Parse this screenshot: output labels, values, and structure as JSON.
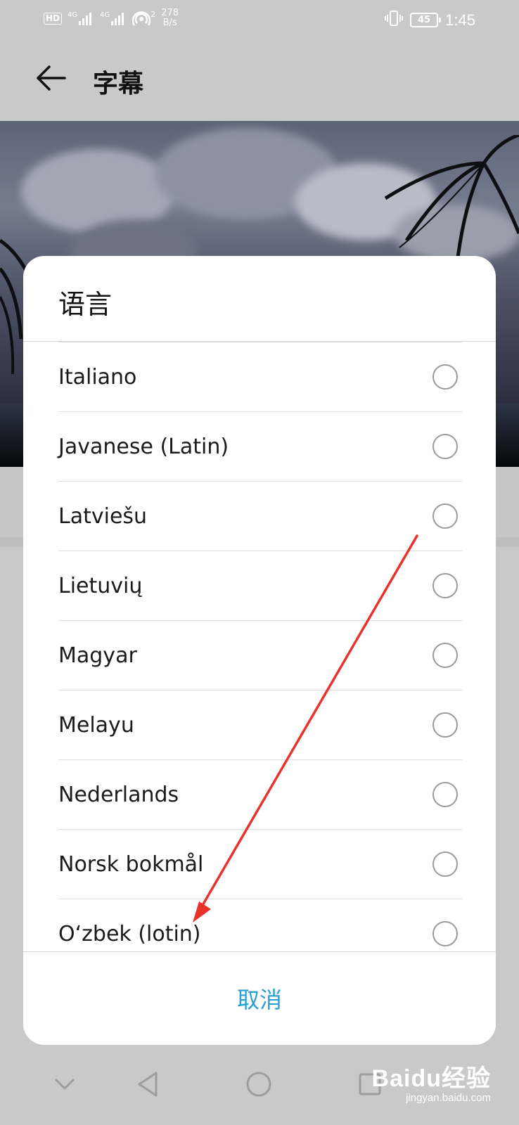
{
  "status_bar": {
    "hd_label": "HD",
    "signal1_label": "4G",
    "signal2_label": "4G",
    "wifi_count": "2",
    "net_speed_value": "278",
    "net_speed_unit": "B/s",
    "battery_level": "45",
    "time": "1:45"
  },
  "app_bar": {
    "title": "字幕",
    "back_icon": "arrow-left-icon"
  },
  "dialog": {
    "title": "语言",
    "options": [
      {
        "label": "Italiano",
        "selected": false
      },
      {
        "label": "Javanese (Latin)",
        "selected": false
      },
      {
        "label": "Latviešu",
        "selected": false
      },
      {
        "label": "Lietuvių",
        "selected": false
      },
      {
        "label": "Magyar",
        "selected": false
      },
      {
        "label": "Melayu",
        "selected": false
      },
      {
        "label": "Nederlands",
        "selected": false
      },
      {
        "label": "Norsk bokmål",
        "selected": false
      },
      {
        "label": "Oʻzbek (lotin)",
        "selected": false
      }
    ],
    "cancel_label": "取消"
  },
  "nav_bar": {
    "icons": [
      "chevron-down-icon",
      "back-triangle-icon",
      "home-circle-icon",
      "recents-square-icon"
    ]
  },
  "watermark": {
    "main": "Baidu经验",
    "sub": "jingyan.baidu.com"
  },
  "colors": {
    "accent": "#2a9fd6",
    "annotation_arrow": "#e8322a",
    "scrim": "#c9c9c9"
  }
}
